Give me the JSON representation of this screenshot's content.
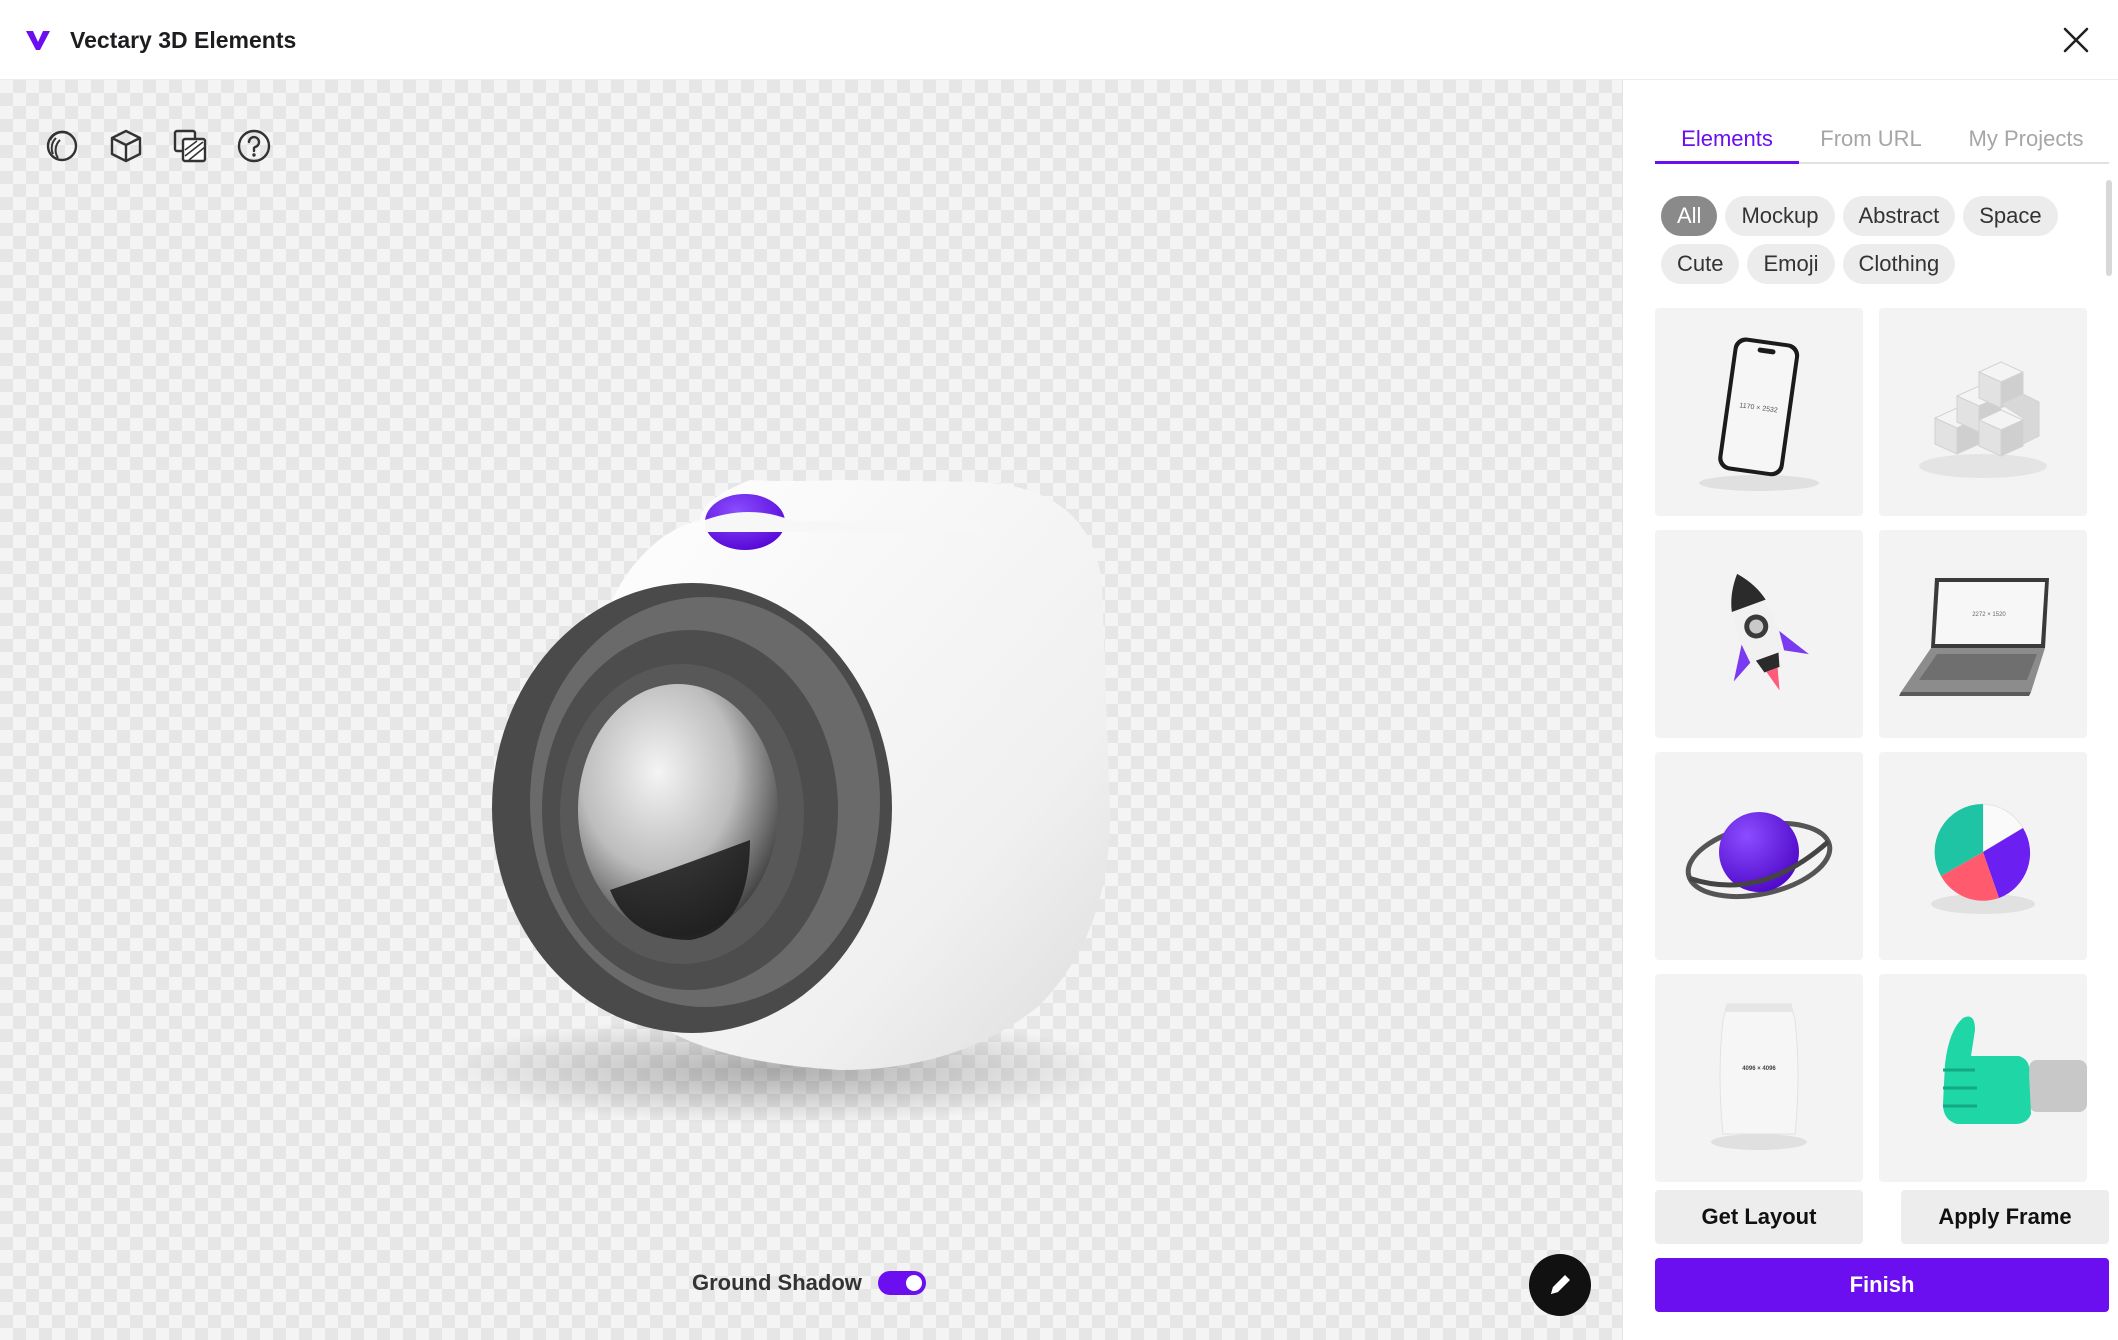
{
  "app": {
    "title": "Vectary 3D Elements",
    "logo": "vectary-logo",
    "accent_color": "#6B0FF0"
  },
  "toolbar": {
    "tools": [
      "lighting-icon",
      "cube-icon",
      "layers-icon",
      "help-icon"
    ]
  },
  "viewport": {
    "ground_shadow_label": "Ground Shadow",
    "ground_shadow_on": true,
    "edit_icon": "pencil-icon"
  },
  "panel": {
    "tabs": [
      {
        "label": "Elements",
        "active": true
      },
      {
        "label": "From URL",
        "active": false
      },
      {
        "label": "My Projects",
        "active": false
      }
    ],
    "filters": [
      {
        "label": "All",
        "active": true
      },
      {
        "label": "Mockup",
        "active": false
      },
      {
        "label": "Abstract",
        "active": false
      },
      {
        "label": "Space",
        "active": false
      },
      {
        "label": "Cute",
        "active": false
      },
      {
        "label": "Emoji",
        "active": false
      },
      {
        "label": "Clothing",
        "active": false
      }
    ],
    "elements": [
      {
        "name": "phone-mockup",
        "screen_text": "1170 × 2532"
      },
      {
        "name": "cubes-stack"
      },
      {
        "name": "rocket"
      },
      {
        "name": "laptop-mockup",
        "screen_text": "2272 × 1520"
      },
      {
        "name": "planet-ring"
      },
      {
        "name": "pie-chart"
      },
      {
        "name": "coffee-bag",
        "label_text": "4096 × 4096"
      },
      {
        "name": "thumbs-up-hand"
      }
    ],
    "get_layout_label": "Get Layout",
    "apply_frame_label": "Apply Frame",
    "finish_label": "Finish"
  }
}
